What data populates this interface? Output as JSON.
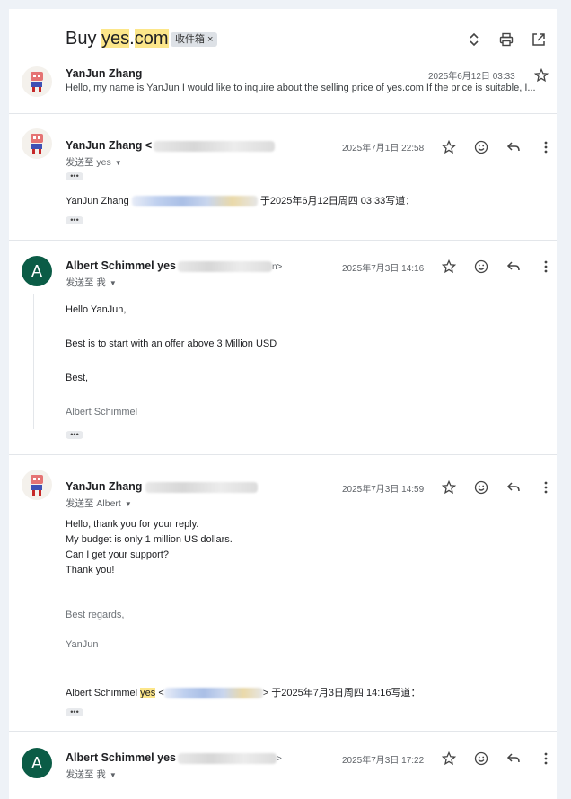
{
  "subject": {
    "prefix": "Buy ",
    "highlight_1": "yes",
    "dot": ".",
    "highlight_2": "com",
    "label": "收件箱 ×"
  },
  "toolbar": {
    "expand_icon": "unfold-icon",
    "print_icon": "print-icon",
    "popout_icon": "open-in-new-icon"
  },
  "messages": [
    {
      "sender": "YanJun Zhang",
      "date": "2025年6月12日 03:33",
      "snippet": "Hello, my name is YanJun I would like to inquire about the selling price of yes.com If the price is suitable, I..."
    },
    {
      "sender": "YanJun Zhang <",
      "recipient": "发送至 yes",
      "date": "2025年7月1日 22:58",
      "dots": "•••",
      "quote_name": "YanJun Zhang",
      "quote_suffix": "于2025年6月12日周四 03:33写道：",
      "dots2": "•••"
    },
    {
      "avatar_letter": "A",
      "sender": "Albert Schimmel yes",
      "sender_tail": "n>",
      "recipient": "发送至 我",
      "date": "2025年7月3日 14:16",
      "lines": [
        "Hello YanJun,",
        "Best is to start with an offer above 3 Million USD",
        "Best,",
        "Albert Schimmel"
      ],
      "dots": "•••"
    },
    {
      "sender": "YanJun Zhang",
      "recipient": "发送至 Albert",
      "date": "2025年7月3日 14:59",
      "lines": [
        "Hello, thank you for your reply.",
        "My budget is only 1 million US dollars.",
        "Can I get your support?",
        "Thank you!",
        "Best regards,",
        "YanJun"
      ],
      "quote_prefix": "Albert Schimmel ",
      "quote_highlight": "yes",
      "quote_lt": " <",
      "quote_suffix": "> 于2025年7月3日周四 14:16写道：",
      "dots": "•••"
    },
    {
      "avatar_letter": "A",
      "sender": "Albert Schimmel yes",
      "sender_tail": ">",
      "recipient": "发送至 我",
      "date": "2025年7月3日 17:22"
    }
  ]
}
